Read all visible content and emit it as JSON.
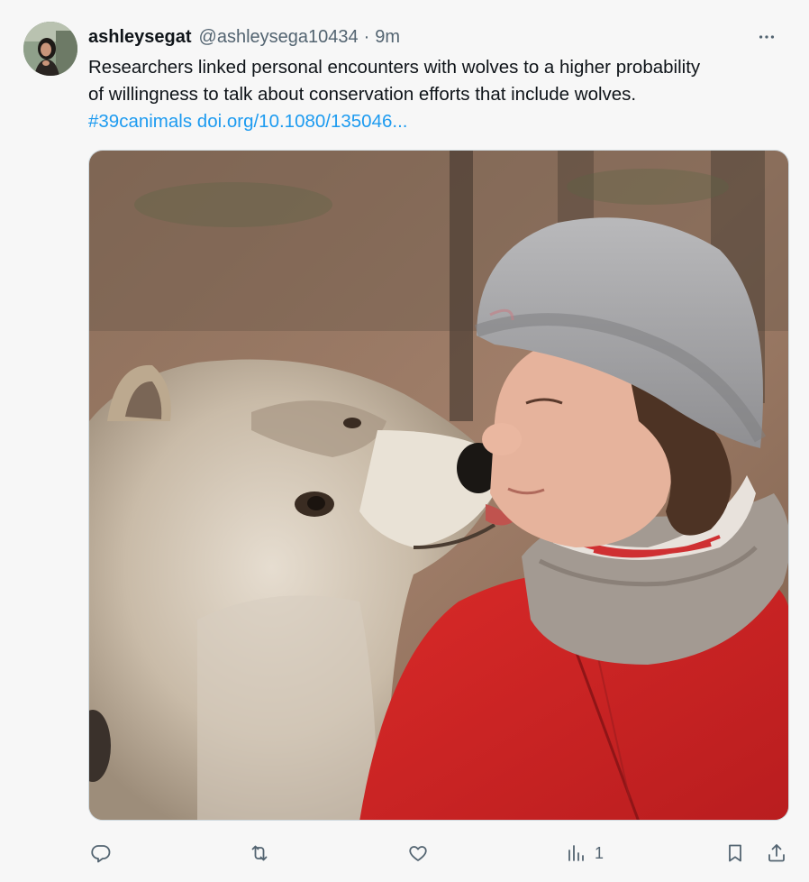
{
  "author": {
    "name": "ashleysegat",
    "handle": "@ashleysega10434",
    "separator": "·",
    "time": "9m",
    "avatar_icon": "profile-photo"
  },
  "tweet": {
    "text_line1": "Researchers linked personal encounters with wolves to a higher probability",
    "text_line2": "of willingness to talk about conservation efforts that include wolves.",
    "hashtag": "#39canimals",
    "link": "doi.org/10.1080/135046..."
  },
  "media": {
    "alt_description_icon": "photo-woman-kissing-wolf"
  },
  "actions": {
    "reply_icon": "reply-icon",
    "retweet_icon": "retweet-icon",
    "like_icon": "like-icon",
    "views_icon": "views-icon",
    "views_count": "1",
    "bookmark_icon": "bookmark-icon",
    "share_icon": "share-icon",
    "more_icon": "more-icon"
  },
  "colors": {
    "link": "#1d9bf0",
    "muted": "#536471",
    "text": "#0f1419"
  }
}
